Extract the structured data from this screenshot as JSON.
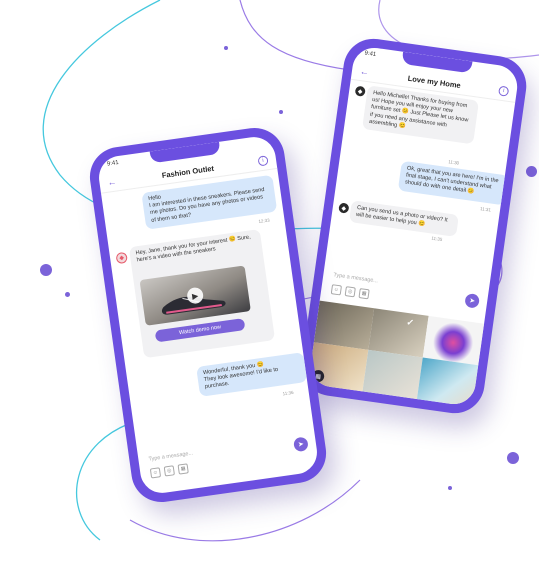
{
  "colors": {
    "accent": "#7b63d9",
    "phone_body": "#6b4fe0",
    "bubble_out": "#d6e7fb",
    "bubble_in": "#f1f1f3",
    "line_cyan": "#45c8de"
  },
  "left_phone": {
    "status_time": "9:41",
    "title": "Fashion Outlet",
    "messages": [
      {
        "text": "Hello\nI am interested in these sneakers. Please send me photos. Do you have any photos or videos of them so that?",
        "time": "12:33"
      },
      {
        "text": "Hey, Jane, thank you for your interest 😊 Sure, here's a video with the sneakers",
        "time": ""
      },
      {
        "text": "Wonderful, thank you 😊\nThey look awesome! I'd like to purchase.",
        "time": "11:36"
      }
    ],
    "watch_button": "Watch demo now",
    "input_placeholder": "Type a message..."
  },
  "right_phone": {
    "status_time": "9:41",
    "title": "Love my Home",
    "messages": [
      {
        "text": "Hello Michelle! Thanks for buying from us! Hope you will enjoy your new furniture set 😊 Just Please let us know if you need any assistance with assembling 😊",
        "time": "11:30"
      },
      {
        "text": "Ok, great that you are here! I'm in the final stage, I can't understand what should do with one detail 😊",
        "time": "11:31"
      },
      {
        "text": "Can you send us a photo or video? It will be easier to help you 😊",
        "time": "11:35"
      }
    ],
    "input_placeholder": "Type a message..."
  }
}
